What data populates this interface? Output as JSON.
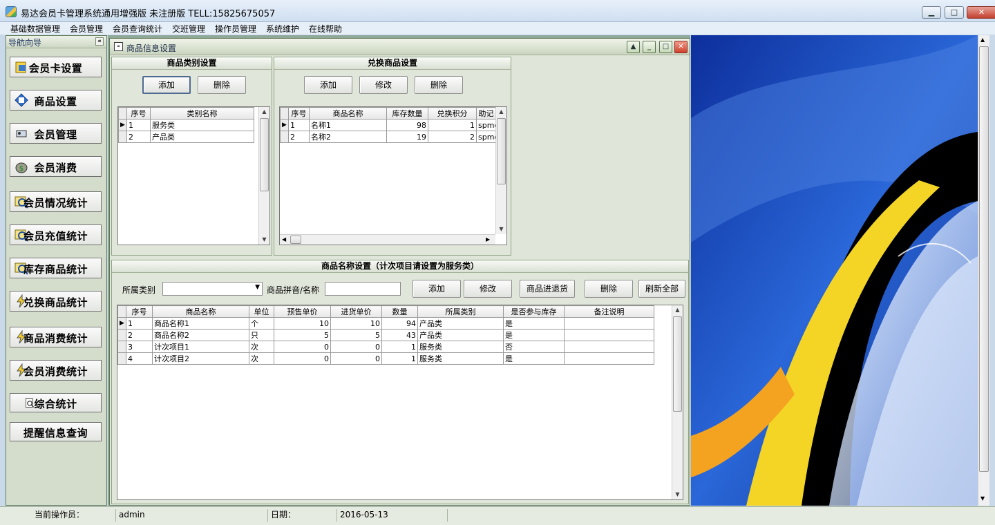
{
  "window": {
    "title": "易达会员卡管理系统通用增强版 未注册版 TELL:15825675057"
  },
  "menu": [
    "基础数据管理",
    "会员管理",
    "会员查询统计",
    "交班管理",
    "操作员管理",
    "系统维护",
    "在线帮助"
  ],
  "nav": {
    "title": "导航向导",
    "buttons": [
      "会员卡设置",
      "商品设置",
      "会员管理",
      "会员消费",
      "会员情况统计",
      "会员充值统计",
      "库存商品统计",
      "兑换商品统计",
      "商品消费统计",
      "会员消费统计",
      "综合统计",
      "提醒信息查询"
    ]
  },
  "child": {
    "title": "商品信息设置",
    "category": {
      "header": "商品类别设置",
      "add": "添加",
      "delete": "删除",
      "columns": [
        "序号",
        "类别名称"
      ],
      "rows": [
        [
          "1",
          "服务类"
        ],
        [
          "2",
          "产品类"
        ]
      ]
    },
    "exchange": {
      "header": "兑换商品设置",
      "add": "添加",
      "edit": "修改",
      "delete": "删除",
      "columns": [
        "序号",
        "商品名称",
        "库存数量",
        "兑换积分",
        "助记"
      ],
      "rows": [
        [
          "1",
          "名称1",
          "98",
          "1",
          "spmc"
        ],
        [
          "2",
          "名称2",
          "19",
          "2",
          "spmc"
        ]
      ]
    },
    "products": {
      "header": "商品名称设置（计次项目请设置为服务类）",
      "category_label": "所属类别",
      "category_value": "",
      "pinyin_label": "商品拼音/名称",
      "pinyin_value": "",
      "add": "添加",
      "edit": "修改",
      "stock": "商品进退货",
      "delete": "删除",
      "refresh": "刷新全部",
      "columns": [
        "序号",
        "商品名称",
        "单位",
        "预售单价",
        "进货单价",
        "数量",
        "所属类别",
        "是否参与库存",
        "备注说明"
      ],
      "rows": [
        [
          "1",
          "商品名称1",
          "个",
          "10",
          "10",
          "94",
          "产品类",
          "是",
          ""
        ],
        [
          "2",
          "商品名称2",
          "只",
          "5",
          "5",
          "43",
          "产品类",
          "是",
          ""
        ],
        [
          "3",
          "计次项目1",
          "次",
          "0",
          "0",
          "1",
          "服务类",
          "否",
          ""
        ],
        [
          "4",
          "计次项目2",
          "次",
          "0",
          "0",
          "1",
          "服务类",
          "是",
          ""
        ]
      ]
    }
  },
  "status": {
    "operator_label": "当前操作员：",
    "operator": "admin",
    "date_label": "日期：",
    "date": "2016-05-13"
  }
}
